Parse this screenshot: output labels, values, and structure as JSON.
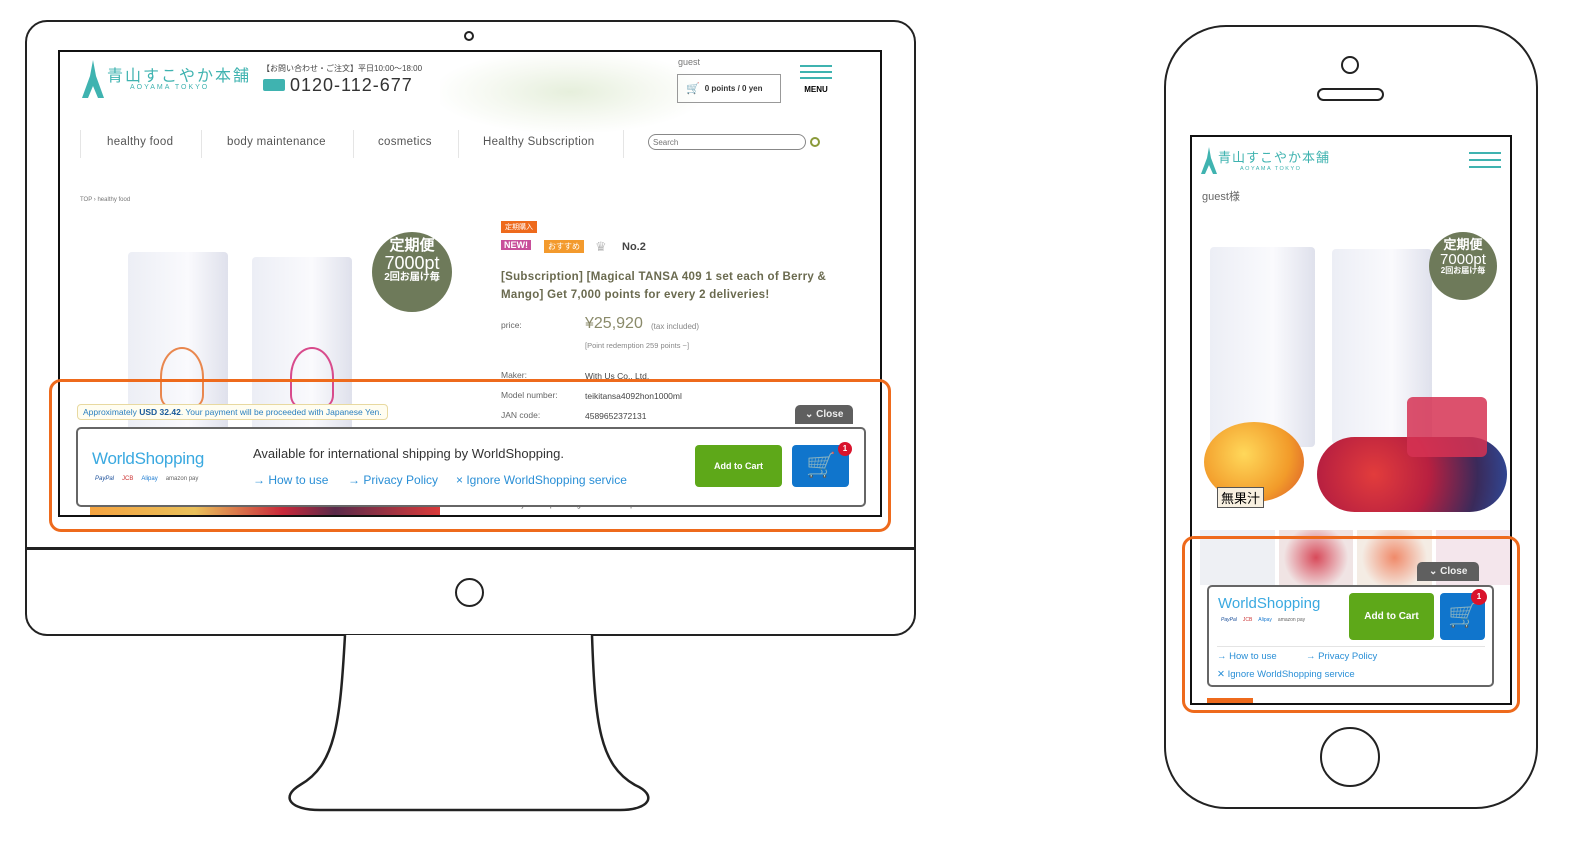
{
  "desktop": {
    "logo": {
      "jp": "青山すこやか本舗",
      "en": "AOYAMA TOKYO"
    },
    "contact": {
      "hours": "【お問い合わせ・ご注文】平日10:00〜18:00",
      "phone": "0120-112-677"
    },
    "user": "guest",
    "cart_summary": "0 points / 0 yen",
    "menu_label": "MENU",
    "nav": [
      "healthy food",
      "body maintenance",
      "cosmetics",
      "Healthy Subscription"
    ],
    "search_placeholder": "Search",
    "breadcrumb": [
      "TOP",
      "healthy food"
    ],
    "promo_badge": {
      "line1": "定期便",
      "line2": "7000pt",
      "line3": "2回お届け毎"
    },
    "product": {
      "tag_subscription": "定期購入",
      "tag_new": "NEW!",
      "tag_recommend": "おすすめ",
      "rank": "No.2",
      "title": "[Subscription] [Magical TANSA 409 1 set each of Berry & Mango] Get 7,000 points for every 2 deliveries!",
      "price_label": "price:",
      "price": "¥25,920",
      "tax": "(tax included)",
      "points": "[Point redemption 259 points ~]",
      "maker_label": "Maker:",
      "maker": "With Us Co., Ltd.",
      "model_label": "Model number:",
      "model": "teikitansa4092hon1000ml",
      "jan_label": "JAN code:",
      "jan": "4589652372131",
      "footer_text": "Healthy Subscription magic TANSA409 2-piece set"
    },
    "worldshopping": {
      "tooltip_prefix": "Approximately ",
      "tooltip_amount": "USD 32.42",
      "tooltip_suffix": ". Your payment will be proceeded with Japanese Yen.",
      "close": "Close",
      "logo": "WorldShopping",
      "payments": [
        "PayPal",
        "JCB",
        "Alipay",
        "amazon pay"
      ],
      "headline": "Available for international shipping by WorldShopping.",
      "how_to_use": "How to use",
      "privacy": "Privacy Policy",
      "ignore": "Ignore WorldShopping service",
      "add_to_cart": "Add to Cart",
      "cart_count": "1"
    }
  },
  "mobile": {
    "logo": {
      "jp": "青山すこやか本舗",
      "en": "AOYAMA TOKYO"
    },
    "user": "guest様",
    "promo_badge": {
      "line1": "定期便",
      "line2": "7000pt",
      "line3": "2回お届け毎"
    },
    "no_juice": "無果汁",
    "worldshopping": {
      "close": "Close",
      "logo": "WorldShopping",
      "add_to_cart": "Add to Cart",
      "cart_count": "1",
      "how_to_use": "How to use",
      "privacy": "Privacy Policy",
      "ignore": "Ignore WorldShopping service"
    }
  },
  "colors": {
    "highlight": "#ee6a1c",
    "add_to_cart": "#5ea819",
    "cart": "#1075cc",
    "teal": "#3fb3b0"
  }
}
